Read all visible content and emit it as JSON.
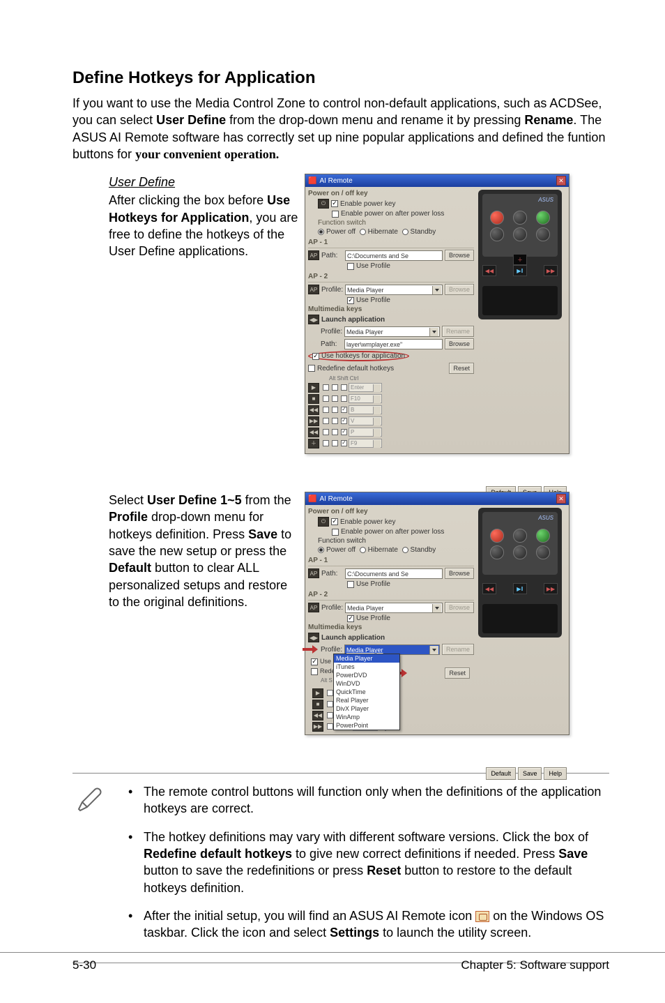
{
  "heading": "Define Hotkeys for Application",
  "intro_html": "If you want to use the Media Control Zone to control non-default applications, such as ACDSee, you can select <b>User Define</b> from the drop-down menu and rename it by pressing <b>Rename</b>. The ASUS AI Remote software has correctly set up nine popular applications and defined the funtion buttons for <span class='bold' style='font-family:serif'>your convenient operation.</span>",
  "user_define": {
    "title": "User Define",
    "para_html": "After clicking the box before <b>Use Hotkeys for Application</b>, you are free to define the hotkeys of the User Define applications."
  },
  "user_define2_html": "Select <b>User Define 1~5</b> from the <b>Profile</b> drop-down menu for hotkeys definition. Press <b>Save</b> to save the new setup or press the <b>Default</b> button to clear ALL personalized setups and restore to the original definitions.",
  "dialog": {
    "title": "AI Remote",
    "power_section": "Power on / off key",
    "enable_power_key": "Enable power key",
    "enable_power_after": "Enable power on after power loss",
    "function_switch": "Function switch",
    "fs_options": {
      "poweroff": "Power off",
      "hibernate": "Hibernate",
      "standby": "Standby"
    },
    "ap1": "AP - 1",
    "ap2": "AP - 2",
    "path_label": "Path:",
    "profile_label": "Profile:",
    "path_value1": "C:\\Documents and Se",
    "profile_value2": "Media Player",
    "use_profile": "Use Profile",
    "browse": "Browse",
    "multimedia_keys": "Multimedia keys",
    "launch_app": "Launch application",
    "launch_profile": "Media Player",
    "launch_path": "layer\\wmplayer.exe\"",
    "rename": "Rename",
    "use_hotkeys": "Use hotkeys for application",
    "redefine": "Redefine default hotkeys",
    "reset": "Reset",
    "alt_shift_ctrl": "Alt Shift Ctrl",
    "hk": [
      "Enter",
      "F10",
      "B",
      "V",
      "P",
      "F9"
    ],
    "bottom_buttons": {
      "default": "Default",
      "save": "Save",
      "help": "Help"
    },
    "dd_options": [
      "Media Player",
      "iTunes",
      "PowerDVD",
      "WinDVD",
      "QuickTime",
      "Real Player",
      "DivX Player",
      "WinAmp",
      "PowerPoint"
    ],
    "remote_logo": "ASUS"
  },
  "notes": [
    "The remote control buttons will function only when the definitions of the application hotkeys are correct.",
    "The hotkey definitions may vary with different software versions. Click the box of <b>Redefine default hotkeys</b> to give new correct definitions if needed. Press <b>Save</b> button to save the redefinitions or press <b>Reset</b> button to restore to the default hotkeys definition.",
    "After the initial setup, you will find an ASUS AI Remote icon <span class='remote-icon' data-name='ai-remote-icon' data-interactable='false'></span> on the Windows OS taskbar. Click the icon and select <b>Settings</b> to launch the utility screen."
  ],
  "footer": {
    "left": "5-30",
    "right": "Chapter 5: Software support"
  }
}
